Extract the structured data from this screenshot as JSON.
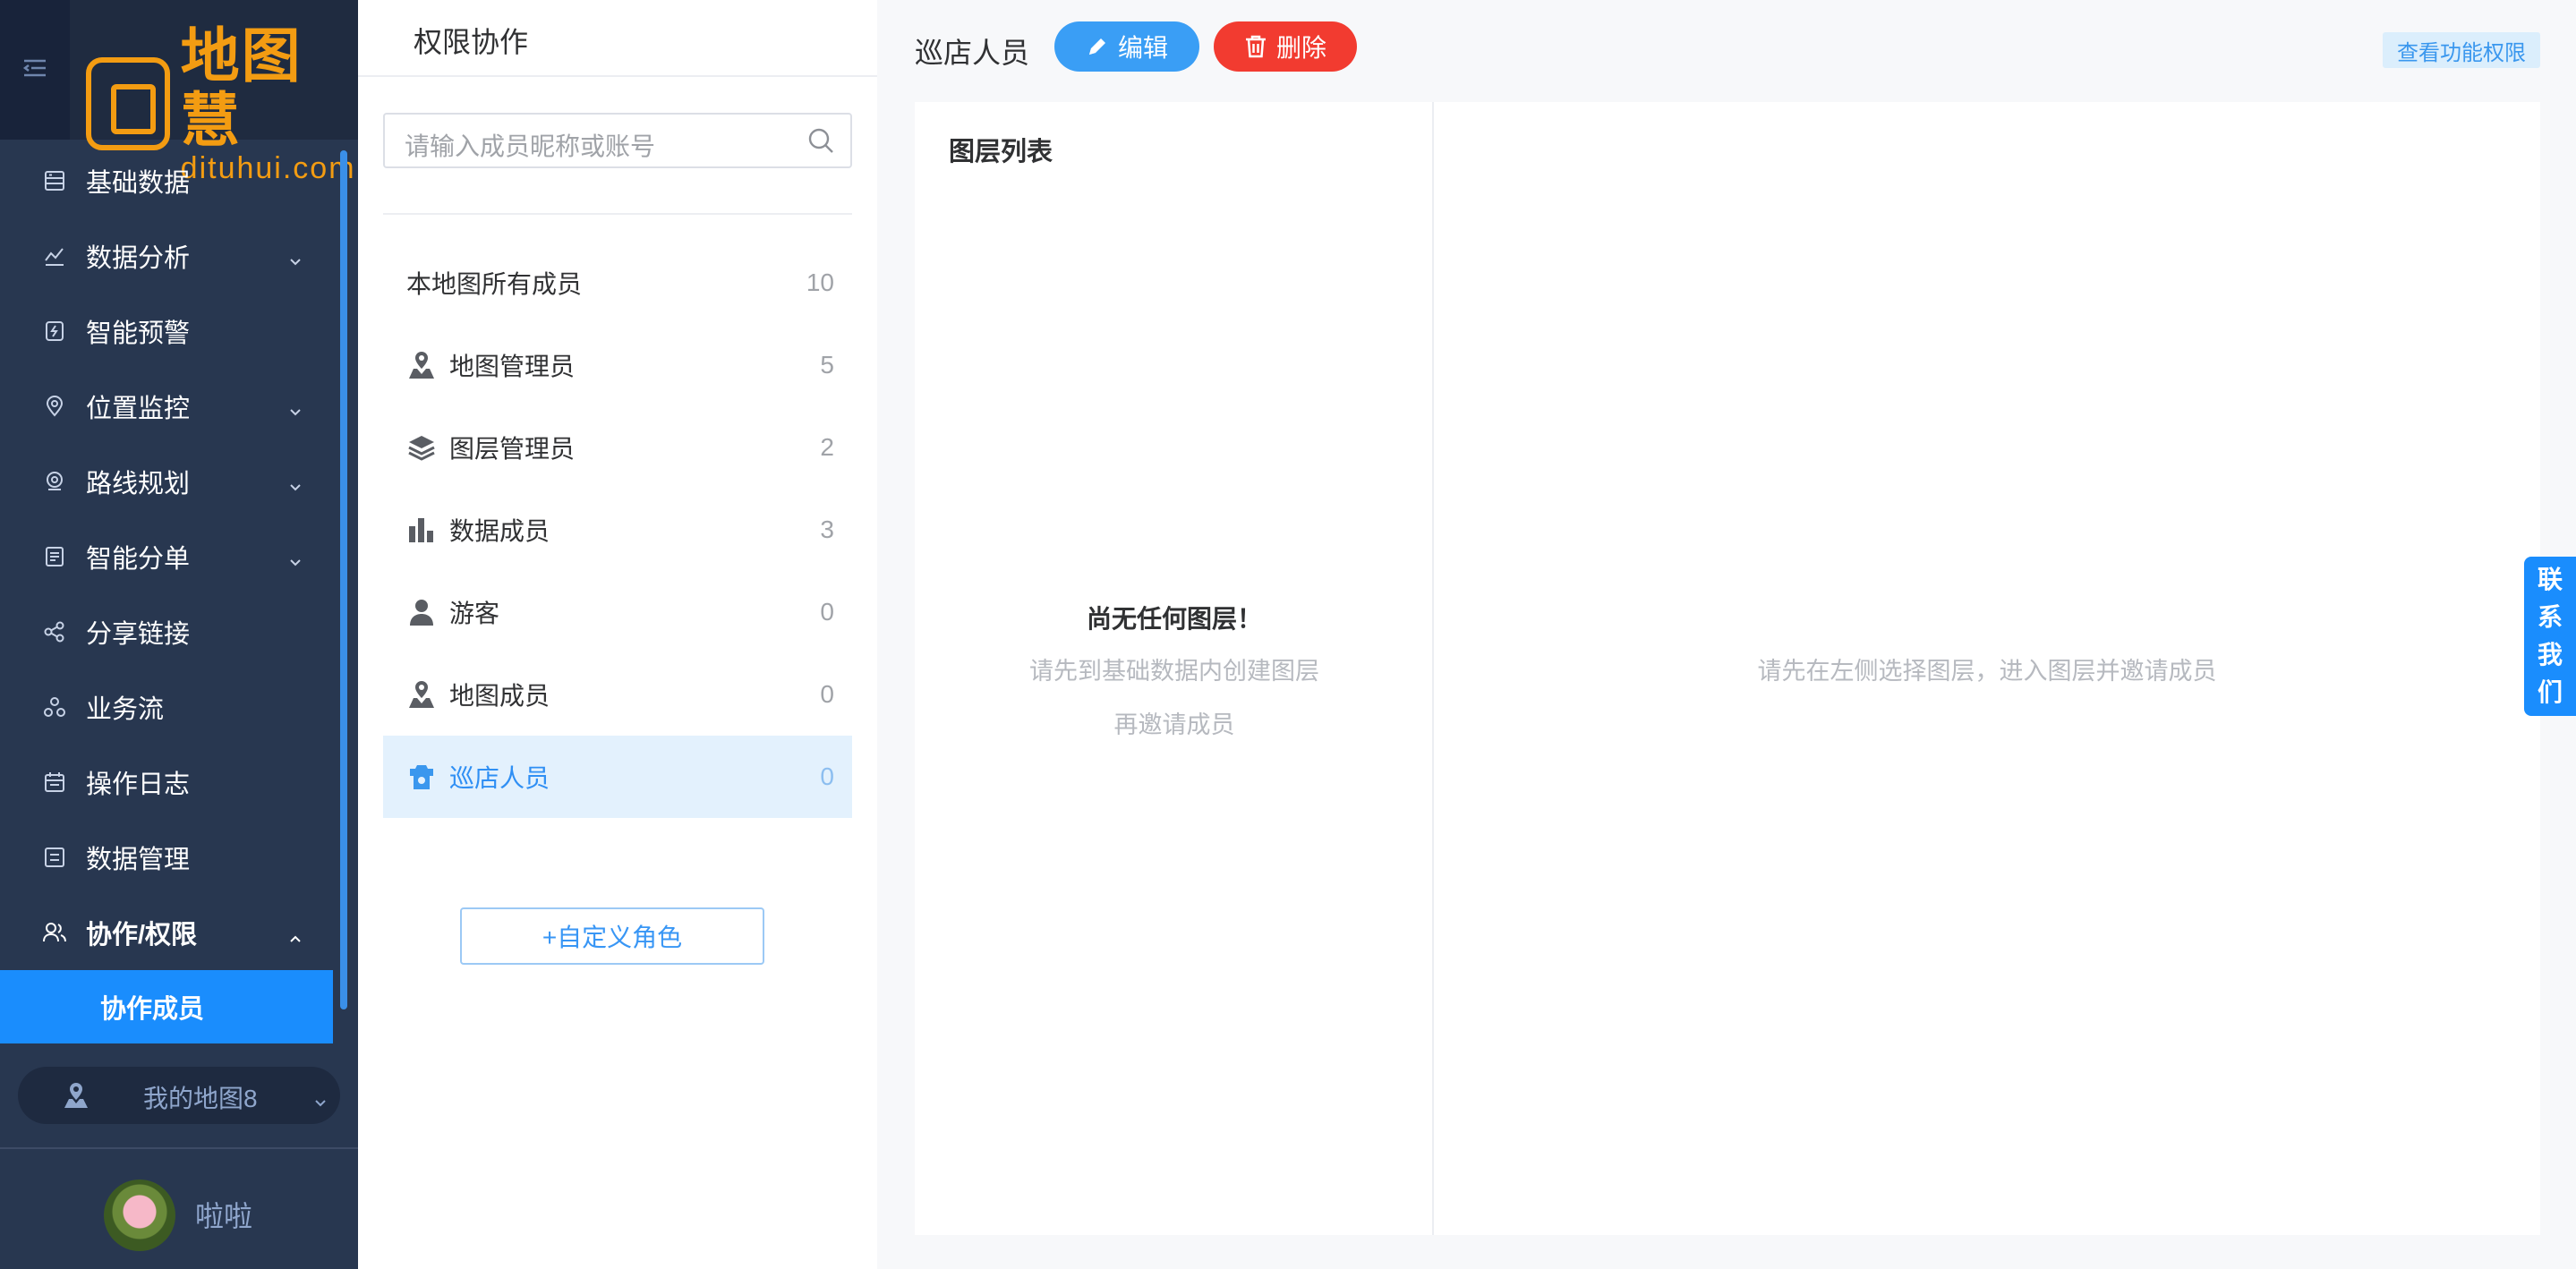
{
  "logo": {
    "cn": "地图慧",
    "en": "dituhui.com"
  },
  "sidebar": {
    "items": [
      {
        "label": "基础数据",
        "icon": "database-icon",
        "chevron": false
      },
      {
        "label": "数据分析",
        "icon": "analysis-icon",
        "chevron": true
      },
      {
        "label": "智能预警",
        "icon": "alert-icon",
        "chevron": false
      },
      {
        "label": "位置监控",
        "icon": "location-icon",
        "chevron": true
      },
      {
        "label": "路线规划",
        "icon": "route-icon",
        "chevron": true
      },
      {
        "label": "智能分单",
        "icon": "dispatch-icon",
        "chevron": true
      },
      {
        "label": "分享链接",
        "icon": "share-icon",
        "chevron": false
      },
      {
        "label": "业务流",
        "icon": "workflow-icon",
        "chevron": false
      },
      {
        "label": "操作日志",
        "icon": "log-icon",
        "chevron": false
      },
      {
        "label": "数据管理",
        "icon": "data-manage-icon",
        "chevron": false
      },
      {
        "label": "协作/权限",
        "icon": "users-icon",
        "chevron": true
      }
    ],
    "sub_active": "协作成员",
    "my_map": "我的地图8",
    "user_name": "啦啦"
  },
  "panel": {
    "title": "权限协作",
    "search_placeholder": "请输入成员昵称或账号",
    "all_members": {
      "label": "本地图所有成员",
      "count": "10"
    },
    "roles": [
      {
        "label": "地图管理员",
        "count": "5",
        "icon": "map-admin-icon"
      },
      {
        "label": "图层管理员",
        "count": "2",
        "icon": "layers-icon"
      },
      {
        "label": "数据成员",
        "count": "3",
        "icon": "bar-chart-icon"
      },
      {
        "label": "游客",
        "count": "0",
        "icon": "person-icon"
      },
      {
        "label": "地图成员",
        "count": "0",
        "icon": "map-member-icon"
      },
      {
        "label": "巡店人员",
        "count": "0",
        "icon": "patrol-icon"
      }
    ],
    "custom_role_button": "+自定义角色"
  },
  "main": {
    "title": "巡店人员",
    "edit_button": "编辑",
    "delete_button": "删除",
    "permission_link": "查看功能权限",
    "layer_list_title": "图层列表",
    "empty_title": "尚无任何图层！",
    "empty_hint_1": "请先到基础数据内创建图层",
    "empty_hint_2": "再邀请成员",
    "right_hint": "请先在左侧选择图层，进入图层并邀请成员"
  },
  "contact": {
    "chars": [
      "联",
      "系",
      "我",
      "们"
    ]
  },
  "colors": {
    "sidebar_bg": "#283750",
    "accent": "#1a8dfd",
    "delete_red": "#f23b30",
    "logo_orange": "#f39c12"
  }
}
